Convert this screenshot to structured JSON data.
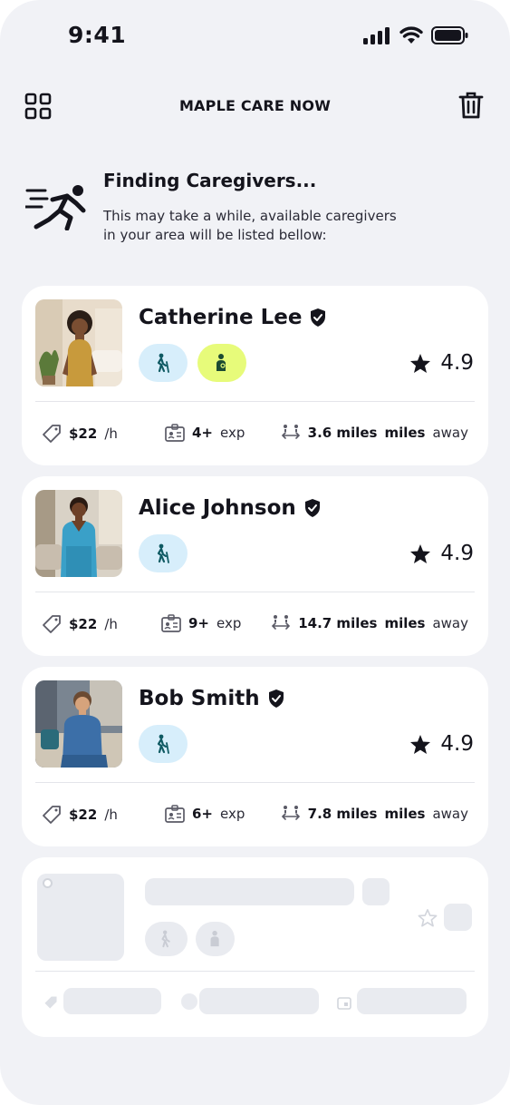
{
  "status_bar": {
    "time": "9:41"
  },
  "header": {
    "title": "MAPLE CARE NOW"
  },
  "finding": {
    "title": "Finding Caregivers...",
    "description": "This may take a while, available caregivers in your  area will be listed bellow:"
  },
  "caregivers": [
    {
      "name": "Catherine Lee",
      "rating": "4.9",
      "price": "$22",
      "price_unit": "/h",
      "exp": "4+",
      "exp_unit": "exp",
      "distance": "3.6 miles",
      "distance_unit": "miles",
      "distance_suffix": "away",
      "badges": [
        "walking-assist-icon",
        "baby-care-icon"
      ]
    },
    {
      "name": "Alice Johnson",
      "rating": "4.9",
      "price": "$22",
      "price_unit": "/h",
      "exp": "9+",
      "exp_unit": "exp",
      "distance": "14.7 miles",
      "distance_unit": "miles",
      "distance_suffix": "away",
      "badges": [
        "walking-assist-icon"
      ]
    },
    {
      "name": "Bob Smith",
      "rating": "4.9",
      "price": "$22",
      "price_unit": "/h",
      "exp": "6+",
      "exp_unit": "exp",
      "distance": "7.8 miles",
      "distance_unit": "miles",
      "distance_suffix": "away",
      "badges": [
        "walking-assist-icon"
      ]
    }
  ],
  "colors": {
    "background": "#f1f2f6",
    "badge_blue": "#d7eefb",
    "badge_yellow": "#e7fb7a",
    "icon_teal": "#0f5a63",
    "skeleton": "#e9ebf0"
  }
}
